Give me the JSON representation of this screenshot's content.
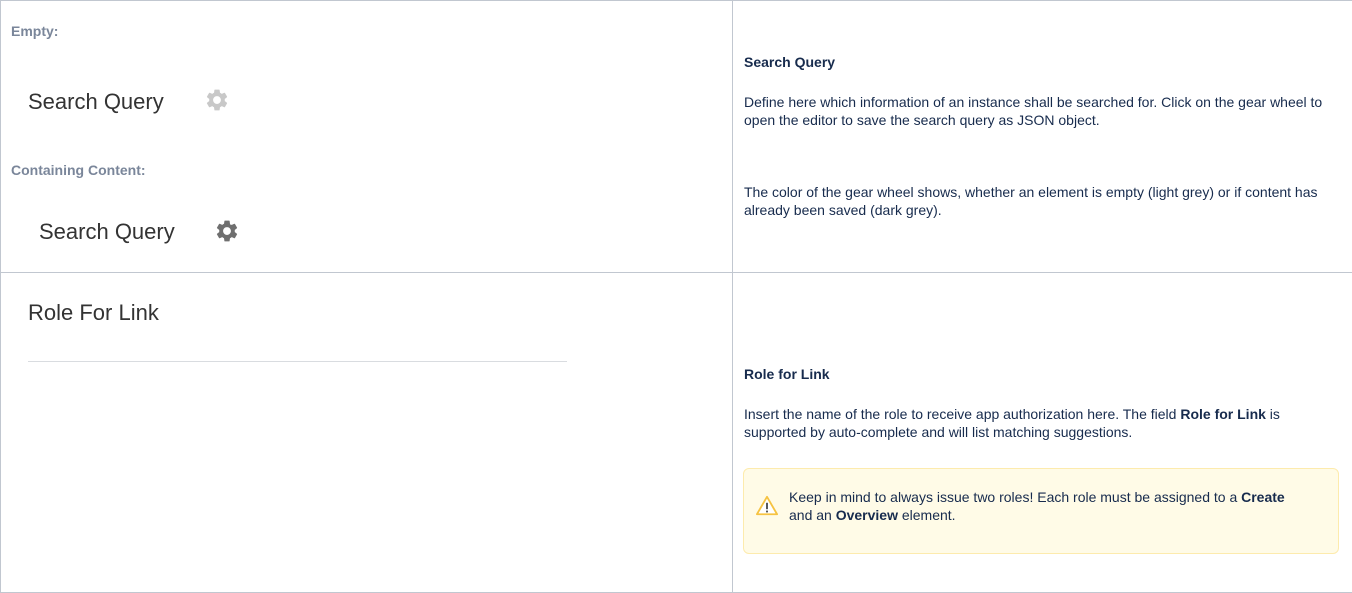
{
  "row1": {
    "empty_label": "Empty:",
    "search_query_label": "Search Query",
    "containing_label": "Containing Content:",
    "search_query_label_2": "Search Query",
    "gear_icon_empty": "gear-icon",
    "gear_icon_filled": "gear-icon",
    "gear_empty_color": "#c8c8c8",
    "gear_filled_color": "#6f6f6f",
    "heading": "Search Query",
    "para1": "Define here which information of an instance shall be searched for. Click on the gear wheel to open the editor to save the search query as JSON object.",
    "para2": "The color of the gear wheel shows, whether an element is empty (light grey) or if content has already been saved (dark grey)."
  },
  "row2": {
    "field_label": "Role For Link",
    "field_value": "",
    "heading": "Role for Link",
    "para1_a": "Insert the name of the role to receive app authorization here. The field ",
    "para1_bold": "Role for Link",
    "para1_b": " is supported by auto-complete and will list matching suggestions.",
    "warning": {
      "icon": "warning-icon",
      "text_a": "Keep in mind to always issue two roles! Each role must be assigned to a ",
      "bold1": "Create",
      "text_b": " and an ",
      "bold2": "Overview",
      "text_c": " element."
    }
  }
}
